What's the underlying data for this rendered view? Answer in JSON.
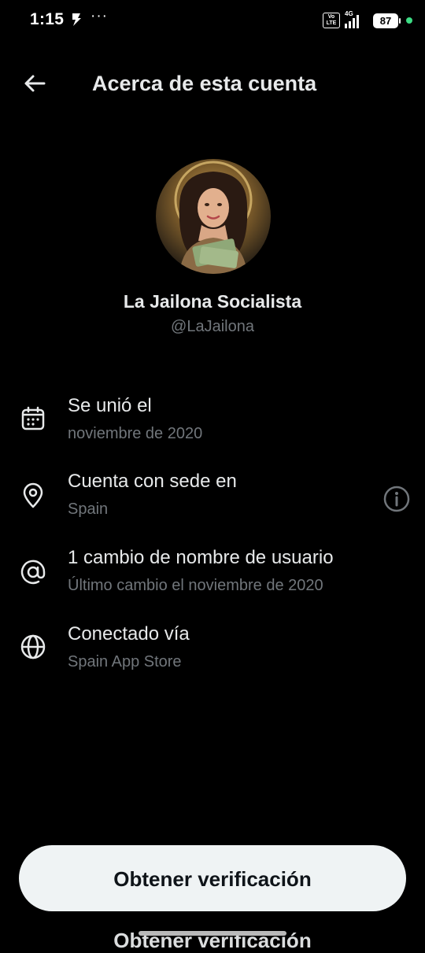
{
  "status_bar": {
    "time": "1:15",
    "dots": "···",
    "volte_label": "Vo LTE",
    "network": "4G",
    "battery": "87"
  },
  "header": {
    "title": "Acerca de esta cuenta",
    "back_icon": "arrow-left-icon"
  },
  "profile": {
    "display_name": "La Jailona Socialista",
    "handle": "@LaJailona"
  },
  "info_rows": [
    {
      "icon": "calendar-icon",
      "title": "Se unió el",
      "subtitle": "noviembre de 2020"
    },
    {
      "icon": "location-pin-icon",
      "title": "Cuenta con sede en",
      "subtitle": "Spain"
    },
    {
      "icon": "at-sign-icon",
      "title": "1 cambio de nombre de usuario",
      "subtitle": "Último cambio el noviembre de 2020"
    },
    {
      "icon": "globe-icon",
      "title": "Conectado vía",
      "subtitle": "Spain App Store"
    }
  ],
  "cta": {
    "label": "Obtener verificación"
  },
  "colors": {
    "background": "#000000",
    "primary_text": "#e7e9ea",
    "secondary_text": "#71767b",
    "button_bg": "#eff3f4",
    "button_text": "#0f1419",
    "status_dot": "#3ddc84"
  }
}
